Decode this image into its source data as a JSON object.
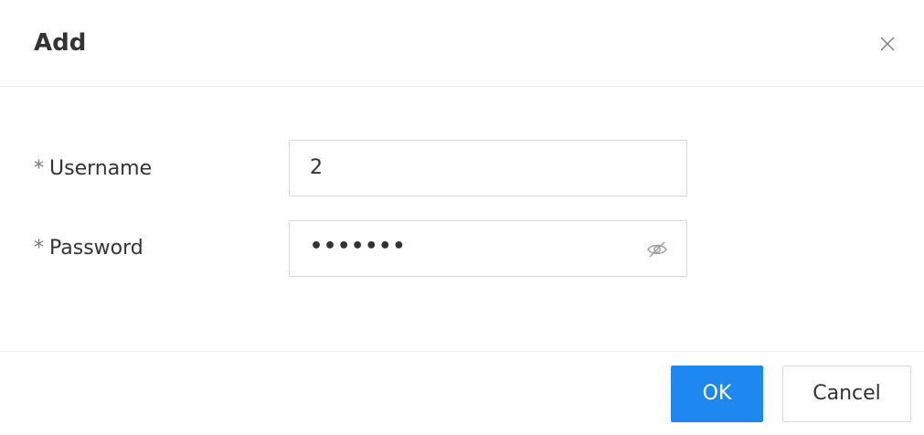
{
  "dialog": {
    "title": "Add",
    "close_icon": "close-icon"
  },
  "form": {
    "username": {
      "required_mark": "*",
      "label": "Username",
      "value": "2"
    },
    "password": {
      "required_mark": "*",
      "label": "Password",
      "masked_value": "•••••••",
      "toggle_icon": "eye-slash-icon"
    }
  },
  "footer": {
    "ok_label": "OK",
    "cancel_label": "Cancel"
  },
  "colors": {
    "primary": "#1e88f0",
    "border": "#d9d9d9",
    "text": "#333333"
  }
}
